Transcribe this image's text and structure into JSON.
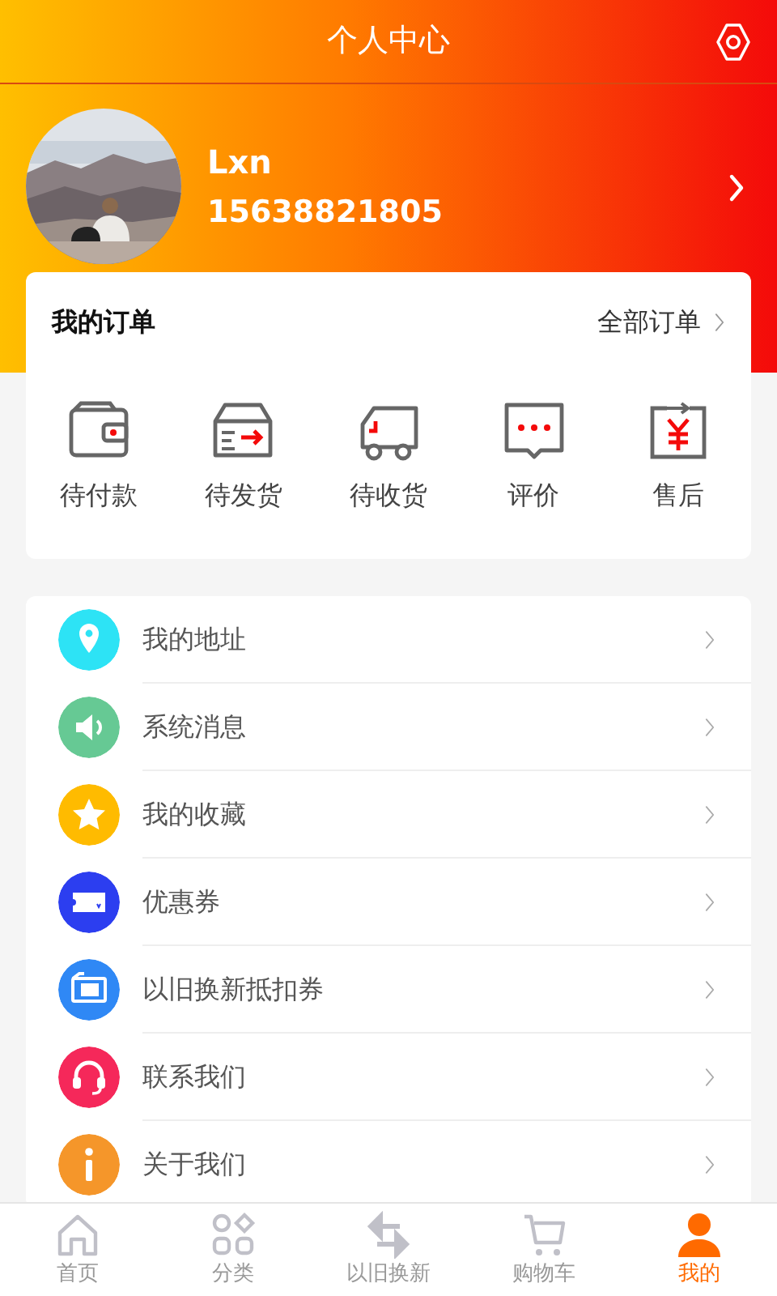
{
  "header": {
    "title": "个人中心"
  },
  "profile": {
    "name": "Lxn",
    "phone": "15638821805"
  },
  "orders": {
    "title": "我的订单",
    "all_link": "全部订单",
    "items": [
      {
        "label": "待付款"
      },
      {
        "label": "待发货"
      },
      {
        "label": "待收货"
      },
      {
        "label": "评价"
      },
      {
        "label": "售后"
      }
    ]
  },
  "menu": [
    {
      "label": "我的地址",
      "color": "#2de3f5"
    },
    {
      "label": "系统消息",
      "color": "#66c994"
    },
    {
      "label": "我的收藏",
      "color": "#ffbb00"
    },
    {
      "label": "优惠券",
      "color": "#2c3ef0"
    },
    {
      "label": "以旧换新抵扣券",
      "color": "#2f88f5"
    },
    {
      "label": "联系我们",
      "color": "#f5285a"
    },
    {
      "label": "关于我们",
      "color": "#f5962a"
    }
  ],
  "tab_bar": [
    {
      "label": "首页",
      "selected": false
    },
    {
      "label": "分类",
      "selected": false
    },
    {
      "label": "以旧换新",
      "selected": false
    },
    {
      "label": "购物车",
      "selected": false
    },
    {
      "label": "我的",
      "selected": true
    }
  ]
}
